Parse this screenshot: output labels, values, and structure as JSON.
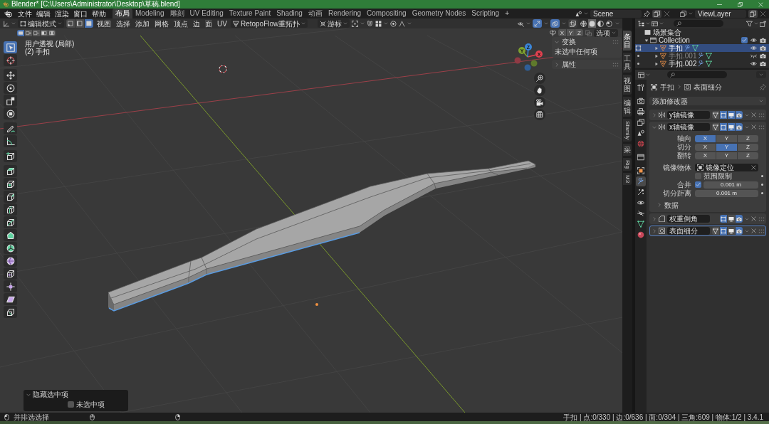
{
  "window": {
    "title": "Blender* [C:\\Users\\Administrator\\Desktop\\草稿.blend]"
  },
  "menu": [
    "文件",
    "编辑",
    "渲染",
    "窗口",
    "帮助"
  ],
  "workspaces": [
    {
      "label": "布局",
      "selected": true
    },
    {
      "label": "Modeling",
      "selected": false
    },
    {
      "label": "雕刻",
      "selected": false
    },
    {
      "label": "UV Editing",
      "selected": false
    },
    {
      "label": "Texture Paint",
      "selected": false
    },
    {
      "label": "Shading",
      "selected": false
    },
    {
      "label": "动画",
      "selected": false
    },
    {
      "label": "Rendering",
      "selected": false
    },
    {
      "label": "Compositing",
      "selected": false
    },
    {
      "label": "Geometry Nodes",
      "selected": false
    },
    {
      "label": "Scripting",
      "selected": false
    }
  ],
  "add_workspace": "+",
  "scene_selector": {
    "scene": "Scene",
    "view_layer": "ViewLayer"
  },
  "viewport_header": {
    "mode": "编辑模式",
    "select_modes": [
      {
        "kind": "vertex",
        "selected": false
      },
      {
        "kind": "edge",
        "selected": false
      },
      {
        "kind": "face",
        "selected": true
      }
    ],
    "menus": [
      "视图",
      "选择",
      "添加",
      "网格",
      "顶点",
      "边",
      "面",
      "UV"
    ],
    "addon_menu": "RetopoFlow重拓扑",
    "orientation": "游标",
    "gizmos": true,
    "overlays": true,
    "xray": false,
    "shading": [
      {
        "kind": "wireframe",
        "selected": false
      },
      {
        "kind": "solid",
        "selected": true
      },
      {
        "kind": "material",
        "selected": false
      },
      {
        "kind": "rendered",
        "selected": false
      }
    ]
  },
  "tool_settings": {
    "select_ops": [
      {
        "kind": "set",
        "selected": true
      },
      {
        "kind": "extend",
        "selected": false
      },
      {
        "kind": "subtract",
        "selected": false
      },
      {
        "kind": "invert",
        "selected": false
      },
      {
        "kind": "intersect",
        "selected": false
      }
    ],
    "mirror_axes": [
      {
        "label": "X",
        "on": false
      },
      {
        "label": "Y",
        "on": false
      },
      {
        "label": "Z",
        "on": false
      }
    ],
    "options": "选项"
  },
  "viewport": {
    "view_name": "用户透视 (局部)",
    "object_name": "(2) 手扣",
    "gizmo_axes": [
      "X",
      "Y",
      "Z"
    ]
  },
  "tools": [
    {
      "kind": "select_box",
      "selected": true
    },
    {
      "kind": "cursor",
      "selected": false
    },
    {
      "kind": "move",
      "selected": false
    },
    {
      "kind": "rotate",
      "selected": false
    },
    {
      "kind": "scale",
      "selected": false
    },
    {
      "kind": "transform",
      "selected": false
    },
    {
      "kind": "annotate",
      "selected": false
    },
    {
      "kind": "measure",
      "selected": false
    },
    {
      "kind": "add_cube",
      "selected": false
    },
    {
      "kind": "extrude",
      "selected": false
    },
    {
      "kind": "inset",
      "selected": false
    },
    {
      "kind": "bevel",
      "selected": false
    },
    {
      "kind": "loop_cut",
      "selected": false
    },
    {
      "kind": "knife",
      "selected": false
    },
    {
      "kind": "poly_build",
      "selected": false
    },
    {
      "kind": "spin",
      "selected": false
    },
    {
      "kind": "smooth",
      "selected": false
    },
    {
      "kind": "edge_slide",
      "selected": false
    },
    {
      "kind": "shrink_fatten",
      "selected": false
    },
    {
      "kind": "shear",
      "selected": false
    },
    {
      "kind": "rip",
      "selected": false
    }
  ],
  "sidebar": {
    "tabs": [
      {
        "label": "条目",
        "kind": "stacked",
        "selected": true
      },
      {
        "label": "工具",
        "kind": "stacked",
        "selected": false
      },
      {
        "label": "视图",
        "kind": "stacked",
        "selected": false
      },
      {
        "label": "编辑",
        "kind": "stacked",
        "selected": false
      },
      {
        "label": "Sfamily",
        "kind": "rotated",
        "selected": false
      },
      {
        "label": "采",
        "kind": "stacked",
        "selected": false
      },
      {
        "label": "Rig",
        "kind": "rotated",
        "selected": false
      },
      {
        "label": "M3",
        "kind": "rotated",
        "selected": false
      }
    ],
    "panels": [
      {
        "title": "变换",
        "expanded": true,
        "text": "未选中任何项"
      },
      {
        "title": "属性",
        "expanded": false
      }
    ]
  },
  "last_operation": {
    "title": "隐藏选中项",
    "expanded": true,
    "option": {
      "label": "未选中项",
      "checked": false
    }
  },
  "outliner": {
    "tree": [
      {
        "label": "场景集合",
        "kind": "scene_collection",
        "selected": false,
        "children": [
          {
            "label": "Collection",
            "kind": "collection",
            "selected": false,
            "expanded": true,
            "checked": true,
            "visible": true,
            "children": [
              {
                "label": "手扣",
                "kind": "object",
                "selected": true,
                "editing": true,
                "expanded": false,
                "visible": true
              },
              {
                "label": "手扣.001",
                "kind": "object",
                "selected": false,
                "editing": false,
                "expanded": false,
                "visible": false
              },
              {
                "label": "手扣.002",
                "kind": "object",
                "selected": false,
                "editing": false,
                "expanded": false,
                "visible": true
              }
            ]
          }
        ]
      }
    ]
  },
  "properties": {
    "tabs": [
      {
        "kind": "tool",
        "selected": false
      },
      {
        "kind": "render",
        "selected": false
      },
      {
        "kind": "output",
        "selected": false
      },
      {
        "kind": "view_layer",
        "selected": false
      },
      {
        "kind": "scene",
        "selected": false
      },
      {
        "kind": "world",
        "selected": false
      },
      {
        "kind": "collection",
        "selected": false
      },
      {
        "kind": "object",
        "selected": false
      },
      {
        "kind": "modifier",
        "selected": true
      },
      {
        "kind": "particles",
        "selected": false
      },
      {
        "kind": "physics",
        "selected": false
      },
      {
        "kind": "constraints",
        "selected": false
      },
      {
        "kind": "data",
        "selected": false
      },
      {
        "kind": "material",
        "selected": false
      }
    ],
    "breadcrumb": [
      {
        "kind": "object",
        "label": "手扣"
      },
      {
        "kind": "subdivision",
        "label": "表面细分"
      }
    ],
    "add_modifier": "添加修改器",
    "modifiers": [
      {
        "kind": "mirror",
        "name": "y轴镜像",
        "expanded": false,
        "active": false,
        "toggles": [
          {
            "kind": "on_cage",
            "on": false
          },
          {
            "kind": "edit_mode",
            "on": true
          },
          {
            "kind": "viewport",
            "on": true
          },
          {
            "kind": "render",
            "on": true
          }
        ]
      },
      {
        "kind": "mirror",
        "name": "x轴镜像",
        "expanded": true,
        "active": false,
        "toggles": [
          {
            "kind": "on_cage",
            "on": false
          },
          {
            "kind": "edit_mode",
            "on": true
          },
          {
            "kind": "viewport",
            "on": true
          },
          {
            "kind": "render",
            "on": true
          }
        ],
        "settings": [
          {
            "kind": "axes",
            "label": "轴向",
            "options": [
              {
                "label": "X",
                "selected": true
              },
              {
                "label": "Y",
                "selected": false
              },
              {
                "label": "Z",
                "selected": false
              }
            ]
          },
          {
            "kind": "axes",
            "label": "切分",
            "options": [
              {
                "label": "X",
                "selected": false
              },
              {
                "label": "Y",
                "selected": true
              },
              {
                "label": "Z",
                "selected": false
              }
            ]
          },
          {
            "kind": "axes",
            "label": "翻转",
            "options": [
              {
                "label": "X",
                "selected": false
              },
              {
                "label": "Y",
                "selected": false
              },
              {
                "label": "Z",
                "selected": false
              }
            ]
          },
          {
            "kind": "object",
            "label": "镜像物体",
            "value": "镜像定位"
          },
          {
            "kind": "checkbox",
            "label": "范围限制",
            "checked": false
          },
          {
            "kind": "toggle_number",
            "label": "合并",
            "checked": true,
            "value": "0.001 m"
          },
          {
            "kind": "number",
            "label": "切分距离",
            "value": "0.001 m"
          }
        ],
        "subpanels": [
          {
            "label": "数据",
            "expanded": false
          }
        ]
      },
      {
        "kind": "bevel",
        "name": "权重倒角",
        "expanded": false,
        "active": false,
        "toggles": [
          {
            "kind": "edit_mode",
            "on": true
          },
          {
            "kind": "viewport",
            "on": false
          },
          {
            "kind": "render",
            "on": true
          }
        ]
      },
      {
        "kind": "subdivision",
        "name": "表面细分",
        "expanded": false,
        "active": true,
        "toggles": [
          {
            "kind": "on_cage",
            "on": false
          },
          {
            "kind": "edit_mode",
            "on": true
          },
          {
            "kind": "viewport",
            "on": false
          },
          {
            "kind": "render",
            "on": true
          }
        ]
      }
    ]
  },
  "status_bar": {
    "hints": [
      {
        "kind": "left_mouse",
        "label": "并排选选择"
      },
      {
        "kind": "middle_mouse"
      },
      {
        "kind": "right_mouse"
      }
    ],
    "stats": "手扣 | 点:0/330 | 边:0/636 | 面:0/304 | 三角:609 | 物体:1/2 | 3.4.1"
  }
}
